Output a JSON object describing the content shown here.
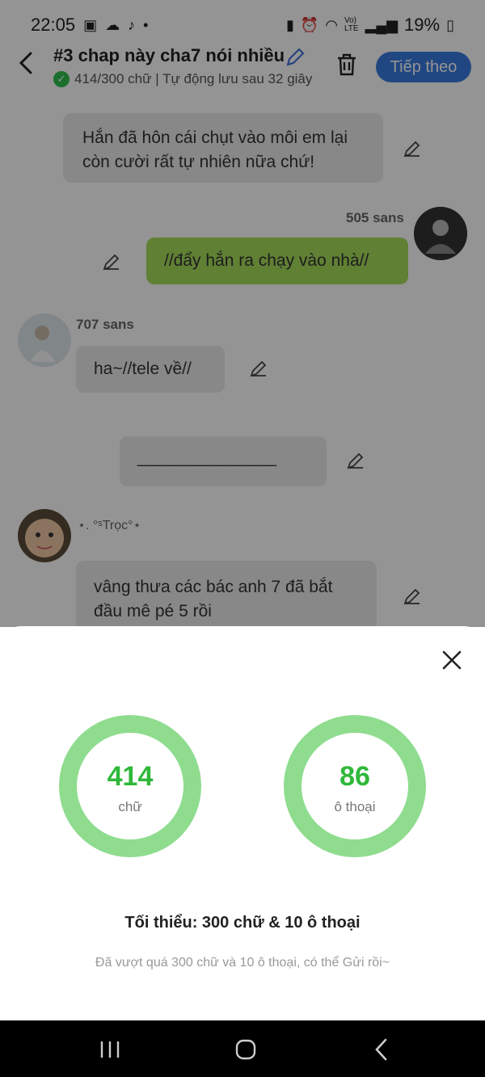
{
  "status_bar": {
    "time": "22:05",
    "battery": "19%",
    "icons": [
      "video-icon",
      "cloud-icon",
      "tiktok-icon",
      "dot-icon",
      "battery-saver-icon",
      "alarm-icon",
      "wifi-icon",
      "volte-icon",
      "signal-icon",
      "battery-icon"
    ]
  },
  "header": {
    "title": "#3 chap này cha7 nói nhiều",
    "subtitle": "414/300 chữ | Tự động lưu sau 32 giây",
    "next_label": "Tiếp theo"
  },
  "chat": {
    "messages": [
      {
        "type": "narration",
        "text": "Hắn đã hôn cái chụt vào môi em lại còn cười rất tự nhiên nữa chứ!"
      },
      {
        "type": "self",
        "name": "505 sans",
        "text": "//đẩy hắn ra chạy vào nhà//"
      },
      {
        "type": "other",
        "name": "707 sans",
        "text": "ha~//tele về//"
      },
      {
        "type": "narration",
        "text": "________________"
      },
      {
        "type": "other",
        "name": "⋆. °ˢTrọc°⋆",
        "text": "vâng thưa các bác anh 7 đã bắt đầu mê pé 5 rồi"
      }
    ]
  },
  "sheet": {
    "words_count": "414",
    "words_unit": "chữ",
    "dialogs_count": "86",
    "dialogs_unit": "ô thoại",
    "minimum": "Tối thiểu: 300 chữ & 10 ô thoại",
    "hint": "Đã vượt quá 300 chữ và 10 ô thoại, có thể Gửi rồi~"
  },
  "colors": {
    "accent": "#3a7be0",
    "ring": "#8fdc8f",
    "count": "#2fb83a",
    "self_bubble": "#a6dc5a",
    "other_bubble": "#ebebeb"
  }
}
